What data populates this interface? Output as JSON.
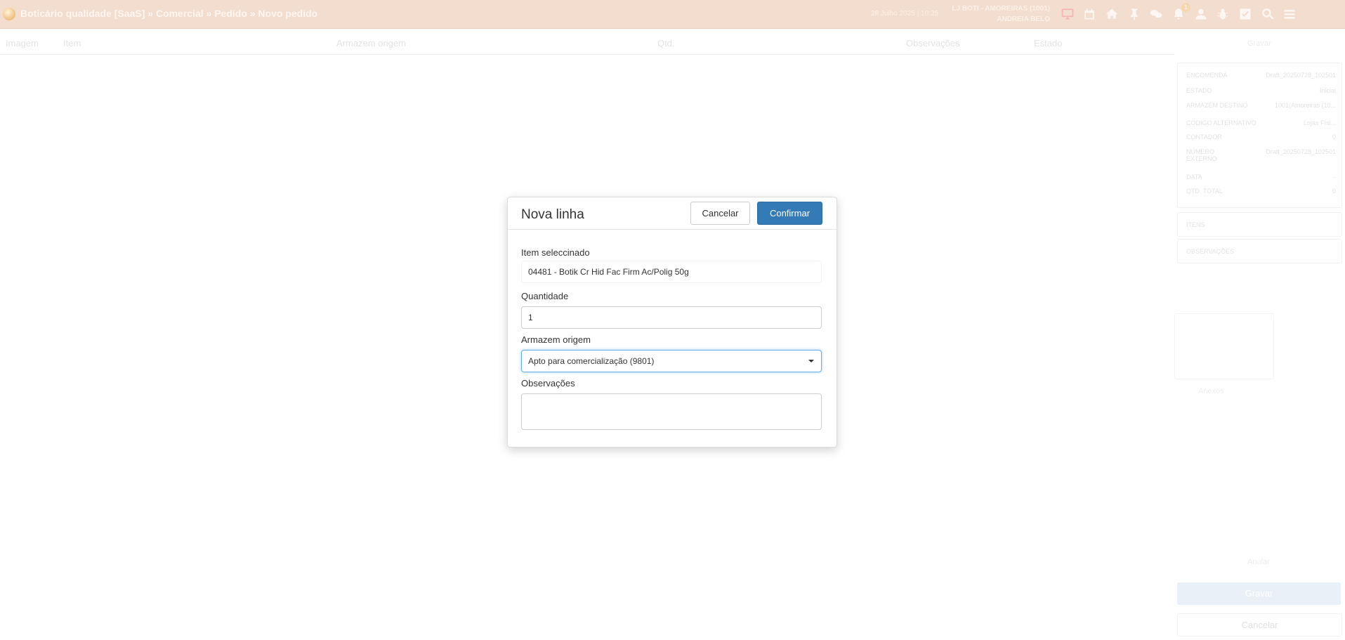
{
  "header": {
    "breadcrumb": "Boticário qualidade [SaaS] » Comercial » Pedido » Novo pedido",
    "datetime": "28 Julho 2025 | 10:25",
    "store": "LJ BOTI - AMOREIRAS (1001)",
    "user": "ANDREIA BELO",
    "notification_count": "1",
    "icons": [
      "monitor-icon",
      "calendar-icon",
      "home-icon",
      "pin-icon",
      "chat-icon",
      "bell-icon",
      "user-icon",
      "bug-icon",
      "checkbox-icon",
      "search-icon",
      "menu-icon"
    ]
  },
  "table": {
    "columns": [
      "Imagem",
      "Item",
      "Armazem origem",
      "Qtd.",
      "Observações",
      "Estado"
    ]
  },
  "right_panel": {
    "title": "Gravar",
    "rows": [
      {
        "label": "Encomenda",
        "value": "Draft_20250728_102501"
      },
      {
        "label": "Estado",
        "value": "Inicial"
      },
      {
        "label": "Armazem destino",
        "value": "1001(Amoreiras (10..."
      },
      {
        "label": "Codigo alternativo",
        "value": "Lojas Físi..."
      },
      {
        "label": "Contador",
        "value": "0"
      },
      {
        "label": "Número externo",
        "value": "Draft_20250728_102501"
      },
      {
        "label": "Data",
        "value": "-"
      },
      {
        "label": "Qtd. total",
        "value": "0"
      }
    ],
    "sections": [
      "ITENS",
      "OBSERVAÇÕES"
    ],
    "link_upload": "Anexos",
    "link_anular": "Anular",
    "save_label": "Gravar",
    "cancel_label": "Cancelar"
  },
  "modal": {
    "title": "Nova linha",
    "cancel_label": "Cancelar",
    "confirm_label": "Confirmar",
    "item_label": "Item seleccinado",
    "item_value": "04481 - Botik Cr Hid Fac Firm Ac/Polig 50g",
    "qty_label": "Quantidade",
    "qty_value": "1",
    "warehouse_label": "Armazem origem",
    "warehouse_value": "Apto para comercialização (9801)",
    "notes_label": "Observações",
    "notes_value": ""
  },
  "colors": {
    "header_bg": "#f3ddcf",
    "primary": "#337ab7",
    "focus_border": "#66afe9"
  }
}
